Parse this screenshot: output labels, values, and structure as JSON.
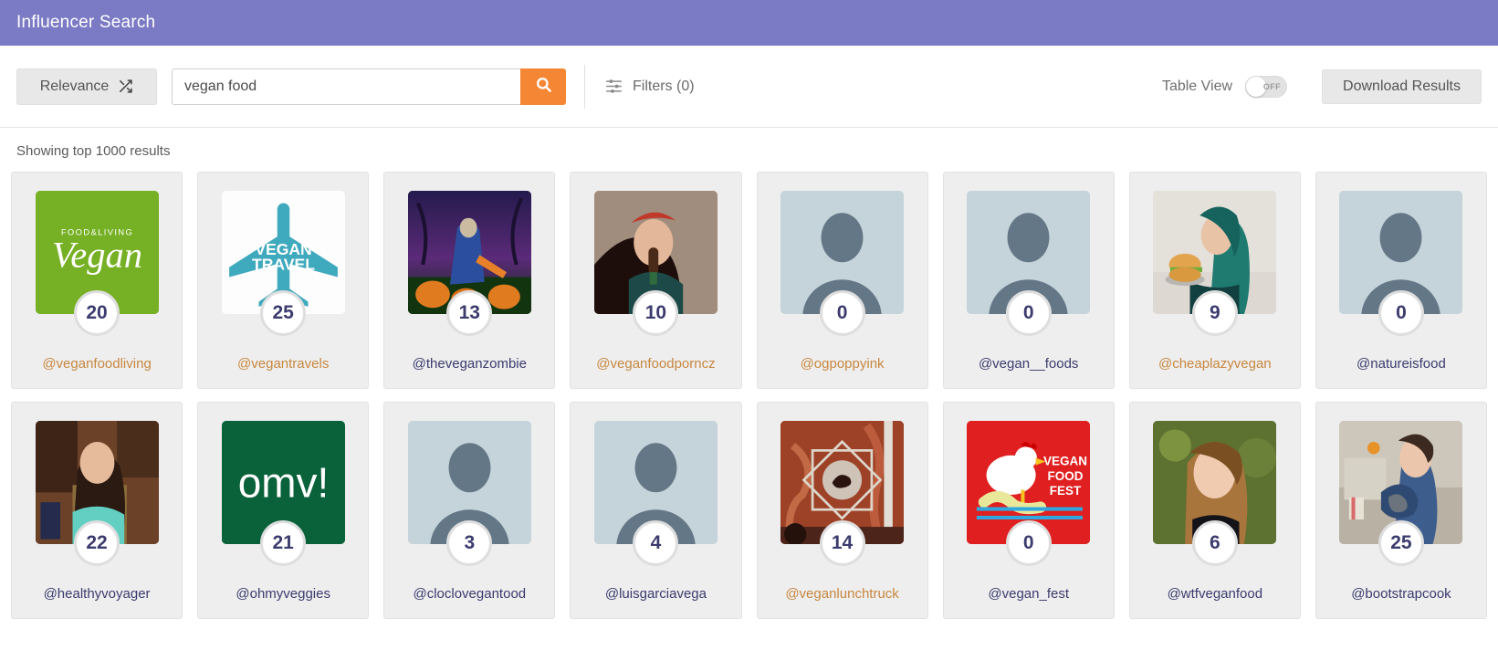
{
  "header": {
    "title": "Influencer Search"
  },
  "toolbar": {
    "sort_label": "Relevance",
    "sort_icon": "shuffle-icon",
    "search_value": "vegan food",
    "search_placeholder": "Search",
    "search_icon": "search-icon",
    "filters_label": "Filters (0)",
    "filters_icon": "sliders-icon",
    "table_view_label": "Table View",
    "toggle_state": "OFF",
    "download_label": "Download Results",
    "accent_color": "#f58634",
    "header_color": "#7b7ac4"
  },
  "results": {
    "count_text": "Showing top 1000 results"
  },
  "cards": [
    {
      "username": "@veganfoodliving",
      "score": "20",
      "visited": true,
      "type": "logo-vegan",
      "bg": "#76b024"
    },
    {
      "username": "@vegantravels",
      "score": "25",
      "visited": true,
      "type": "logo-travel",
      "bg": "#ffffff"
    },
    {
      "username": "@theveganzombie",
      "score": "13",
      "visited": false,
      "type": "photo-zombie",
      "bg": "#1c1838"
    },
    {
      "username": "@veganfoodporncz",
      "score": "10",
      "visited": true,
      "type": "photo-woman-popsicle",
      "bg": "#9b8476"
    },
    {
      "username": "@ogpoppyink",
      "score": "0",
      "visited": true,
      "type": "placeholder",
      "bg": "#c5d3da"
    },
    {
      "username": "@vegan__foods",
      "score": "0",
      "visited": false,
      "type": "placeholder",
      "bg": "#c5d3da"
    },
    {
      "username": "@cheaplazyvegan",
      "score": "9",
      "visited": true,
      "type": "photo-burger-girl",
      "bg": "#d8d3cc"
    },
    {
      "username": "@natureisfood",
      "score": "0",
      "visited": false,
      "type": "placeholder",
      "bg": "#c5d3da"
    },
    {
      "username": "@healthyvoyager",
      "score": "22",
      "visited": false,
      "type": "photo-kitchen-woman",
      "bg": "#5b3a28"
    },
    {
      "username": "@ohmyveggies",
      "score": "21",
      "visited": false,
      "type": "logo-omv",
      "bg": "#09623a"
    },
    {
      "username": "@cloclovegantood",
      "score": "3",
      "visited": false,
      "type": "placeholder",
      "bg": "#c5d3da"
    },
    {
      "username": "@luisgarciavega",
      "score": "4",
      "visited": false,
      "type": "placeholder",
      "bg": "#c5d3da"
    },
    {
      "username": "@veganlunchtruck",
      "score": "14",
      "visited": true,
      "type": "photo-truck",
      "bg": "#9d3d2a"
    },
    {
      "username": "@vegan_fest",
      "score": "0",
      "visited": false,
      "type": "logo-fest",
      "bg": "#e02020"
    },
    {
      "username": "@wtfveganfood",
      "score": "6",
      "visited": false,
      "type": "photo-portrait-green",
      "bg": "#56632e"
    },
    {
      "username": "@bootstrapcook",
      "score": "25",
      "visited": false,
      "type": "photo-cafe-woman",
      "bg": "#c4bdb4"
    }
  ],
  "labels": {
    "card_username": "username",
    "card_score": "score"
  }
}
